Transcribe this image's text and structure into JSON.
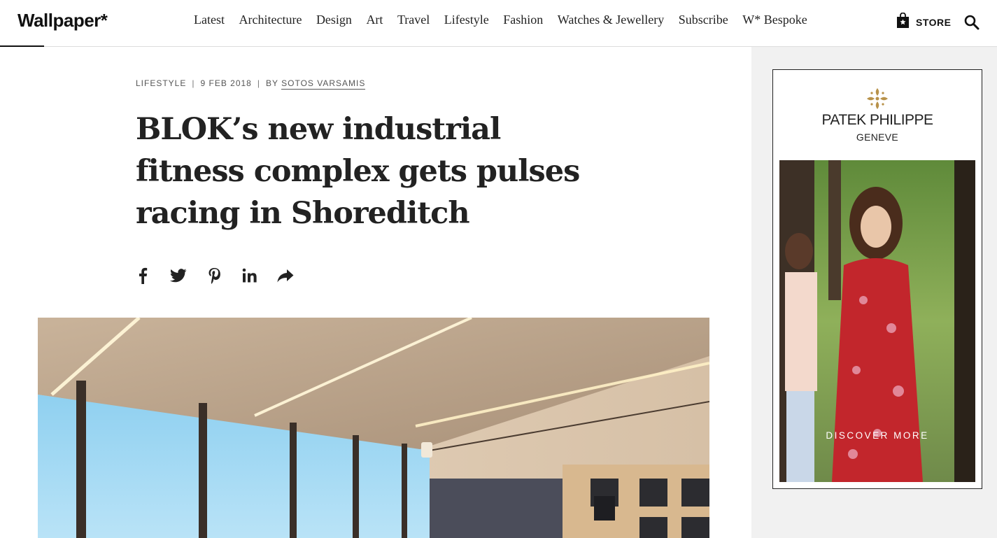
{
  "header": {
    "logo": "Wallpaper*",
    "nav": [
      "Latest",
      "Architecture",
      "Design",
      "Art",
      "Travel",
      "Lifestyle",
      "Fashion",
      "Watches & Jewellery",
      "Subscribe",
      "W* Bespoke"
    ],
    "store_label": "STORE",
    "icons": {
      "store": "shopping-bag-icon",
      "search": "search-icon"
    }
  },
  "article": {
    "category": "LIFESTYLE",
    "date": "9 FEB 2018",
    "by": "BY",
    "author": "SOTOS VARSAMIS",
    "headline": "BLOK’s new industrial fitness complex gets pulses racing in Shoreditch",
    "share_icons": [
      "facebook-icon",
      "twitter-icon",
      "pinterest-icon",
      "linkedin-icon",
      "share-icon"
    ]
  },
  "ad": {
    "brand": "PATEK PHILIPPE",
    "location": "GENEVE",
    "cta": "DISCOVER MORE"
  },
  "colors": {
    "text": "#222222",
    "sidebar_bg": "#f1f1f1",
    "ad_gold": "#b8924a"
  }
}
